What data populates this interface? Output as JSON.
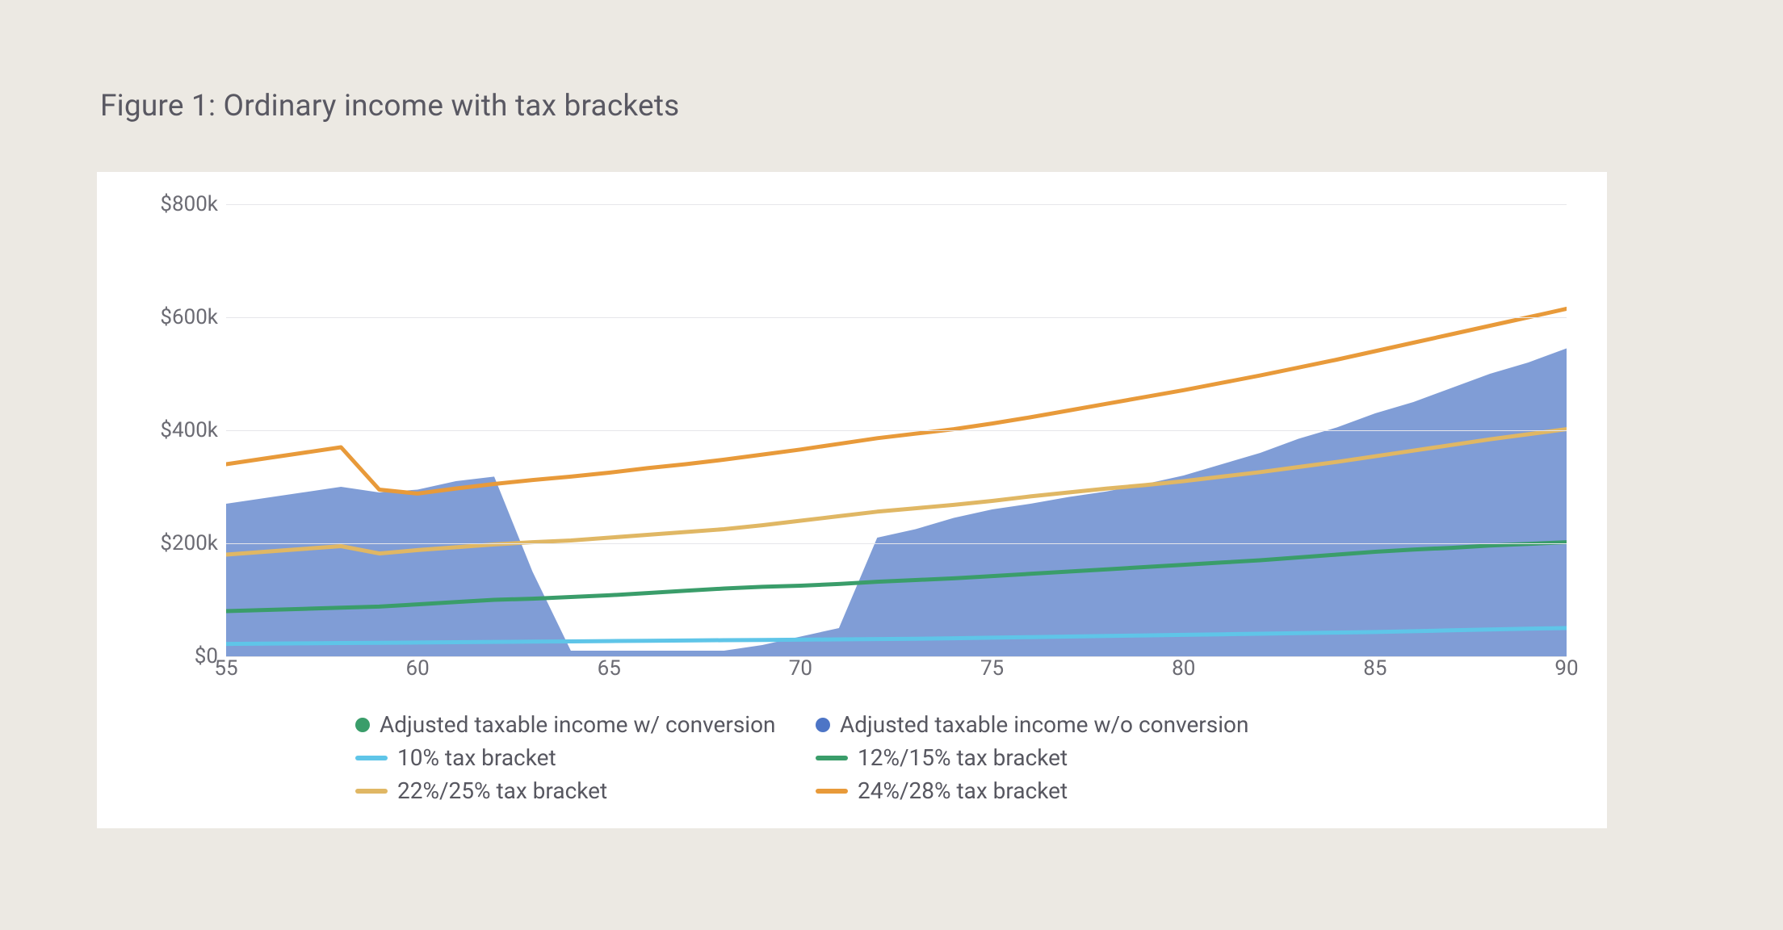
{
  "title": "Figure 1: Ordinary income with tax brackets",
  "y_ticks": [
    "$0",
    "$200k",
    "$400k",
    "$600k",
    "$800k"
  ],
  "x_ticks": [
    "55",
    "60",
    "65",
    "70",
    "75",
    "80",
    "85",
    "90"
  ],
  "legend": [
    {
      "label": "Adjusted taxable income w/ conversion",
      "kind": "dot",
      "color": "#3a9d6a"
    },
    {
      "label": "Adjusted taxable income w/o conversion",
      "kind": "dot",
      "color": "#4d75c6"
    },
    {
      "label": "10% tax bracket",
      "kind": "line",
      "color": "#5fc5e8"
    },
    {
      "label": "12%/15% tax bracket",
      "kind": "line",
      "color": "#3a9d6a"
    },
    {
      "label": "22%/25% tax bracket",
      "kind": "line",
      "color": "#e0b764"
    },
    {
      "label": "24%/28% tax bracket",
      "kind": "line",
      "color": "#e89a3a"
    }
  ],
  "chart_data": {
    "type": "area",
    "title": "Figure 1: Ordinary income with tax brackets",
    "xlabel": "",
    "ylabel": "",
    "ylim": [
      0,
      800000
    ],
    "xlim": [
      55,
      90
    ],
    "x": [
      55,
      56,
      57,
      58,
      59,
      60,
      61,
      62,
      63,
      64,
      65,
      66,
      67,
      68,
      69,
      70,
      71,
      72,
      73,
      74,
      75,
      76,
      77,
      78,
      79,
      80,
      81,
      82,
      83,
      84,
      85,
      86,
      87,
      88,
      89,
      90
    ],
    "series": [
      {
        "name": "Adjusted taxable income w/o conversion",
        "type": "area",
        "color": "#6a8ccf",
        "values": [
          270000,
          280000,
          290000,
          300000,
          290000,
          295000,
          310000,
          318000,
          150000,
          10000,
          10000,
          10000,
          10000,
          10000,
          20000,
          35000,
          50000,
          210000,
          225000,
          245000,
          260000,
          270000,
          282000,
          292000,
          305000,
          320000,
          340000,
          360000,
          385000,
          405000,
          430000,
          450000,
          475000,
          500000,
          520000,
          545000
        ]
      },
      {
        "name": "10% tax bracket",
        "type": "line",
        "color": "#5fc5e8",
        "values": [
          22000,
          22500,
          23000,
          23500,
          24000,
          24500,
          25000,
          25500,
          26000,
          26500,
          27000,
          27500,
          28000,
          28500,
          29000,
          29500,
          30000,
          30500,
          31000,
          32000,
          33000,
          34000,
          35000,
          36000,
          37000,
          38000,
          39000,
          40000,
          41000,
          42000,
          43000,
          44500,
          46000,
          47500,
          49000,
          50000
        ]
      },
      {
        "name": "12%/15% tax bracket",
        "type": "line",
        "color": "#3a9d6a",
        "values": [
          80000,
          82000,
          84000,
          86000,
          88000,
          92000,
          96000,
          100000,
          102000,
          105000,
          108000,
          112000,
          116000,
          120000,
          123000,
          125000,
          128000,
          132000,
          135000,
          138000,
          142000,
          146000,
          150000,
          154000,
          158000,
          162000,
          166000,
          170000,
          175000,
          180000,
          185000,
          189000,
          192000,
          196000,
          199000,
          202000
        ]
      },
      {
        "name": "22%/25% tax bracket",
        "type": "line",
        "color": "#e0b764",
        "values": [
          180000,
          185000,
          190000,
          195000,
          182000,
          188000,
          193000,
          198000,
          202000,
          205000,
          210000,
          215000,
          220000,
          225000,
          232000,
          240000,
          248000,
          256000,
          262000,
          268000,
          275000,
          283000,
          290000,
          297000,
          303000,
          310000,
          318000,
          326000,
          335000,
          344000,
          354000,
          364000,
          374000,
          384000,
          393000,
          402000
        ]
      },
      {
        "name": "24%/28% tax bracket",
        "type": "line",
        "color": "#e89a3a",
        "values": [
          340000,
          350000,
          360000,
          370000,
          295000,
          288000,
          297000,
          305000,
          312000,
          318000,
          325000,
          333000,
          340000,
          348000,
          357000,
          366000,
          376000,
          386000,
          394000,
          402000,
          412000,
          423000,
          435000,
          447000,
          459000,
          471000,
          484000,
          497000,
          511000,
          525000,
          540000,
          555000,
          570000,
          585000,
          600000,
          615000
        ]
      }
    ]
  }
}
